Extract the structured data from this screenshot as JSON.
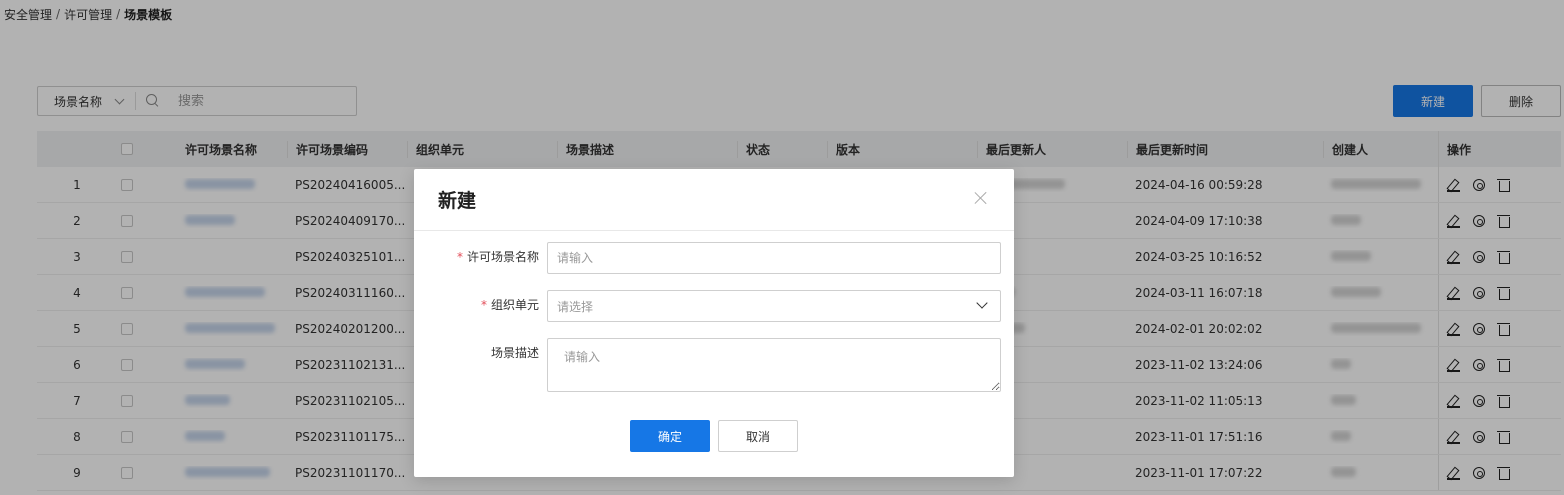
{
  "breadcrumb": {
    "items": [
      "安全管理",
      "许可管理",
      "场景模板"
    ],
    "separator": "/"
  },
  "toolbar": {
    "search_field": "场景名称",
    "search_placeholder": "搜索",
    "new_label": "新建",
    "delete_label": "删除"
  },
  "table": {
    "headers": {
      "name": "许可场景名称",
      "code": "许可场景编码",
      "org": "组织单元",
      "desc": "场景描述",
      "status": "状态",
      "version": "版本",
      "updater": "最后更新人",
      "updated_at": "最后更新时间",
      "creator": "创建人",
      "ops": "操作"
    },
    "rows": [
      {
        "idx": "1",
        "code": "PS20240416005...",
        "updated_at": "2024-04-16 00:59:28"
      },
      {
        "idx": "2",
        "code": "PS20240409170...",
        "updated_at": "2024-04-09 17:10:38"
      },
      {
        "idx": "3",
        "code": "PS20240325101...",
        "updated_at": "2024-03-25 10:16:52"
      },
      {
        "idx": "4",
        "code": "PS20240311160...",
        "updated_at": "2024-03-11 16:07:18"
      },
      {
        "idx": "5",
        "code": "PS20240201200...",
        "updated_at": "2024-02-01 20:02:02"
      },
      {
        "idx": "6",
        "code": "PS20231102131...",
        "updated_at": "2023-11-02 13:24:06"
      },
      {
        "idx": "7",
        "code": "PS20231102105...",
        "updated_at": "2023-11-02 11:05:13"
      },
      {
        "idx": "8",
        "code": "PS20231101175...",
        "updated_at": "2023-11-01 17:51:16"
      },
      {
        "idx": "9",
        "code": "PS20231101170...",
        "updated_at": "2023-11-01 17:07:22"
      }
    ]
  },
  "modal": {
    "title": "新建",
    "fields": {
      "name_label": "许可场景名称",
      "name_placeholder": "请输入",
      "org_label": "组织单元",
      "org_placeholder": "请选择",
      "desc_label": "场景描述",
      "desc_placeholder": "请输入"
    },
    "required_mark": "*",
    "ok_label": "确定",
    "cancel_label": "取消"
  },
  "colors": {
    "primary": "#1677e6",
    "required": "#e34d59"
  }
}
